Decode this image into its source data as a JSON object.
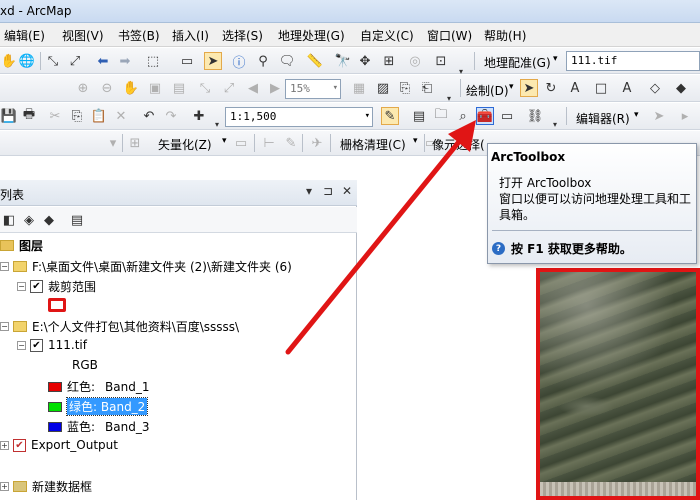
{
  "window": {
    "title": "xd - ArcMap"
  },
  "menu": [
    "编辑(E)",
    "视图(V)",
    "书签(B)",
    "插入(I)",
    "选择(S)",
    "地理处理(G)",
    "自定义(C)",
    "窗口(W)",
    "帮助(H)"
  ],
  "toolbar1": {
    "georef_label": "地理配准(G)",
    "layer_combo": "111.tif"
  },
  "toolbar2": {
    "zoom_combo": "15%",
    "draw_label": "绘制(D)"
  },
  "toolbar3": {
    "scale_combo": "1:1,500",
    "editor_label": "编辑器(R)"
  },
  "toolbar4": {
    "vectorize_label": "矢量化(Z)",
    "raster_clean_label": "栅格清理(C)",
    "image_label": "像元选择("
  },
  "tooltip": {
    "title": "ArcToolbox",
    "body": "打开 ArcToolbox\n窗口以便可以访问地理处理工具和工具箱。",
    "help": "按 F1 获取更多帮助。"
  },
  "toc": {
    "title": "列表",
    "root_label": "图层",
    "groups": [
      {
        "path": "F:\\桌面文件\\桌面\\新建文件夹 (2)\\新建文件夹 (6)",
        "layer": "裁剪范围"
      },
      {
        "path": "E:\\个人文件打包\\其他资料\\百度\\sssss\\",
        "layer": "111.tif"
      }
    ],
    "rgb_label": "RGB",
    "bands": [
      {
        "prefix": "红色:",
        "band": "Band_1",
        "color": "#e60000"
      },
      {
        "prefix": "绿色:",
        "band": "Band_2",
        "color": "#00e000",
        "selected": true
      },
      {
        "prefix": "蓝色:",
        "band": "Band_3",
        "color": "#0000e6"
      }
    ],
    "export_label": "Export_Output",
    "new_frame_label": "新建数据框"
  },
  "colors": {
    "annotation_red": "#e01515",
    "selection_blue": "#3399ff"
  }
}
